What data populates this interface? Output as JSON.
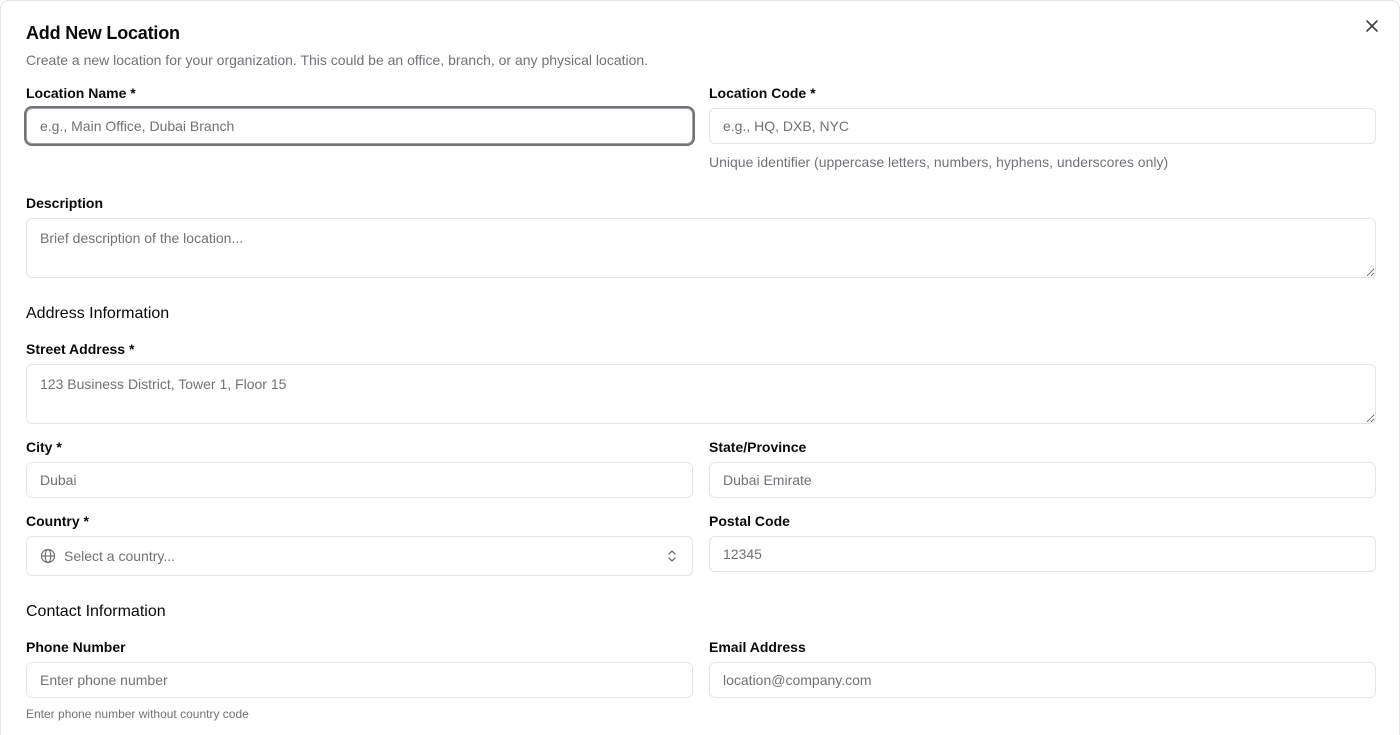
{
  "dialog": {
    "title": "Add New Location",
    "subtitle": "Create a new location for your organization. This could be an office, branch, or any physical location."
  },
  "fields": {
    "location_name": {
      "label": "Location Name *",
      "placeholder": "e.g., Main Office, Dubai Branch",
      "value": ""
    },
    "location_code": {
      "label": "Location Code *",
      "placeholder": "e.g., HQ, DXB, NYC",
      "value": "",
      "helper": "Unique identifier (uppercase letters, numbers, hyphens, underscores only)"
    },
    "description": {
      "label": "Description",
      "placeholder": "Brief description of the location...",
      "value": ""
    }
  },
  "address": {
    "section_title": "Address Information",
    "street": {
      "label": "Street Address *",
      "placeholder": "123 Business District, Tower 1, Floor 15",
      "value": ""
    },
    "city": {
      "label": "City *",
      "placeholder": "Dubai",
      "value": ""
    },
    "state": {
      "label": "State/Province",
      "placeholder": "Dubai Emirate",
      "value": ""
    },
    "country": {
      "label": "Country *",
      "selected_text": "Select a country..."
    },
    "postal": {
      "label": "Postal Code",
      "placeholder": "12345",
      "value": ""
    }
  },
  "contact": {
    "section_title": "Contact Information",
    "phone": {
      "label": "Phone Number",
      "placeholder": "Enter phone number",
      "value": "",
      "helper": "Enter phone number without country code"
    },
    "email": {
      "label": "Email Address",
      "placeholder": "location@company.com",
      "value": ""
    }
  },
  "icons": {
    "close": "close-icon",
    "globe": "globe-icon",
    "chevron": "chevron-up-down-icon"
  },
  "colors": {
    "border": "#e4e4e7",
    "muted_text": "#71717a",
    "focus_ring": "#71717a"
  }
}
